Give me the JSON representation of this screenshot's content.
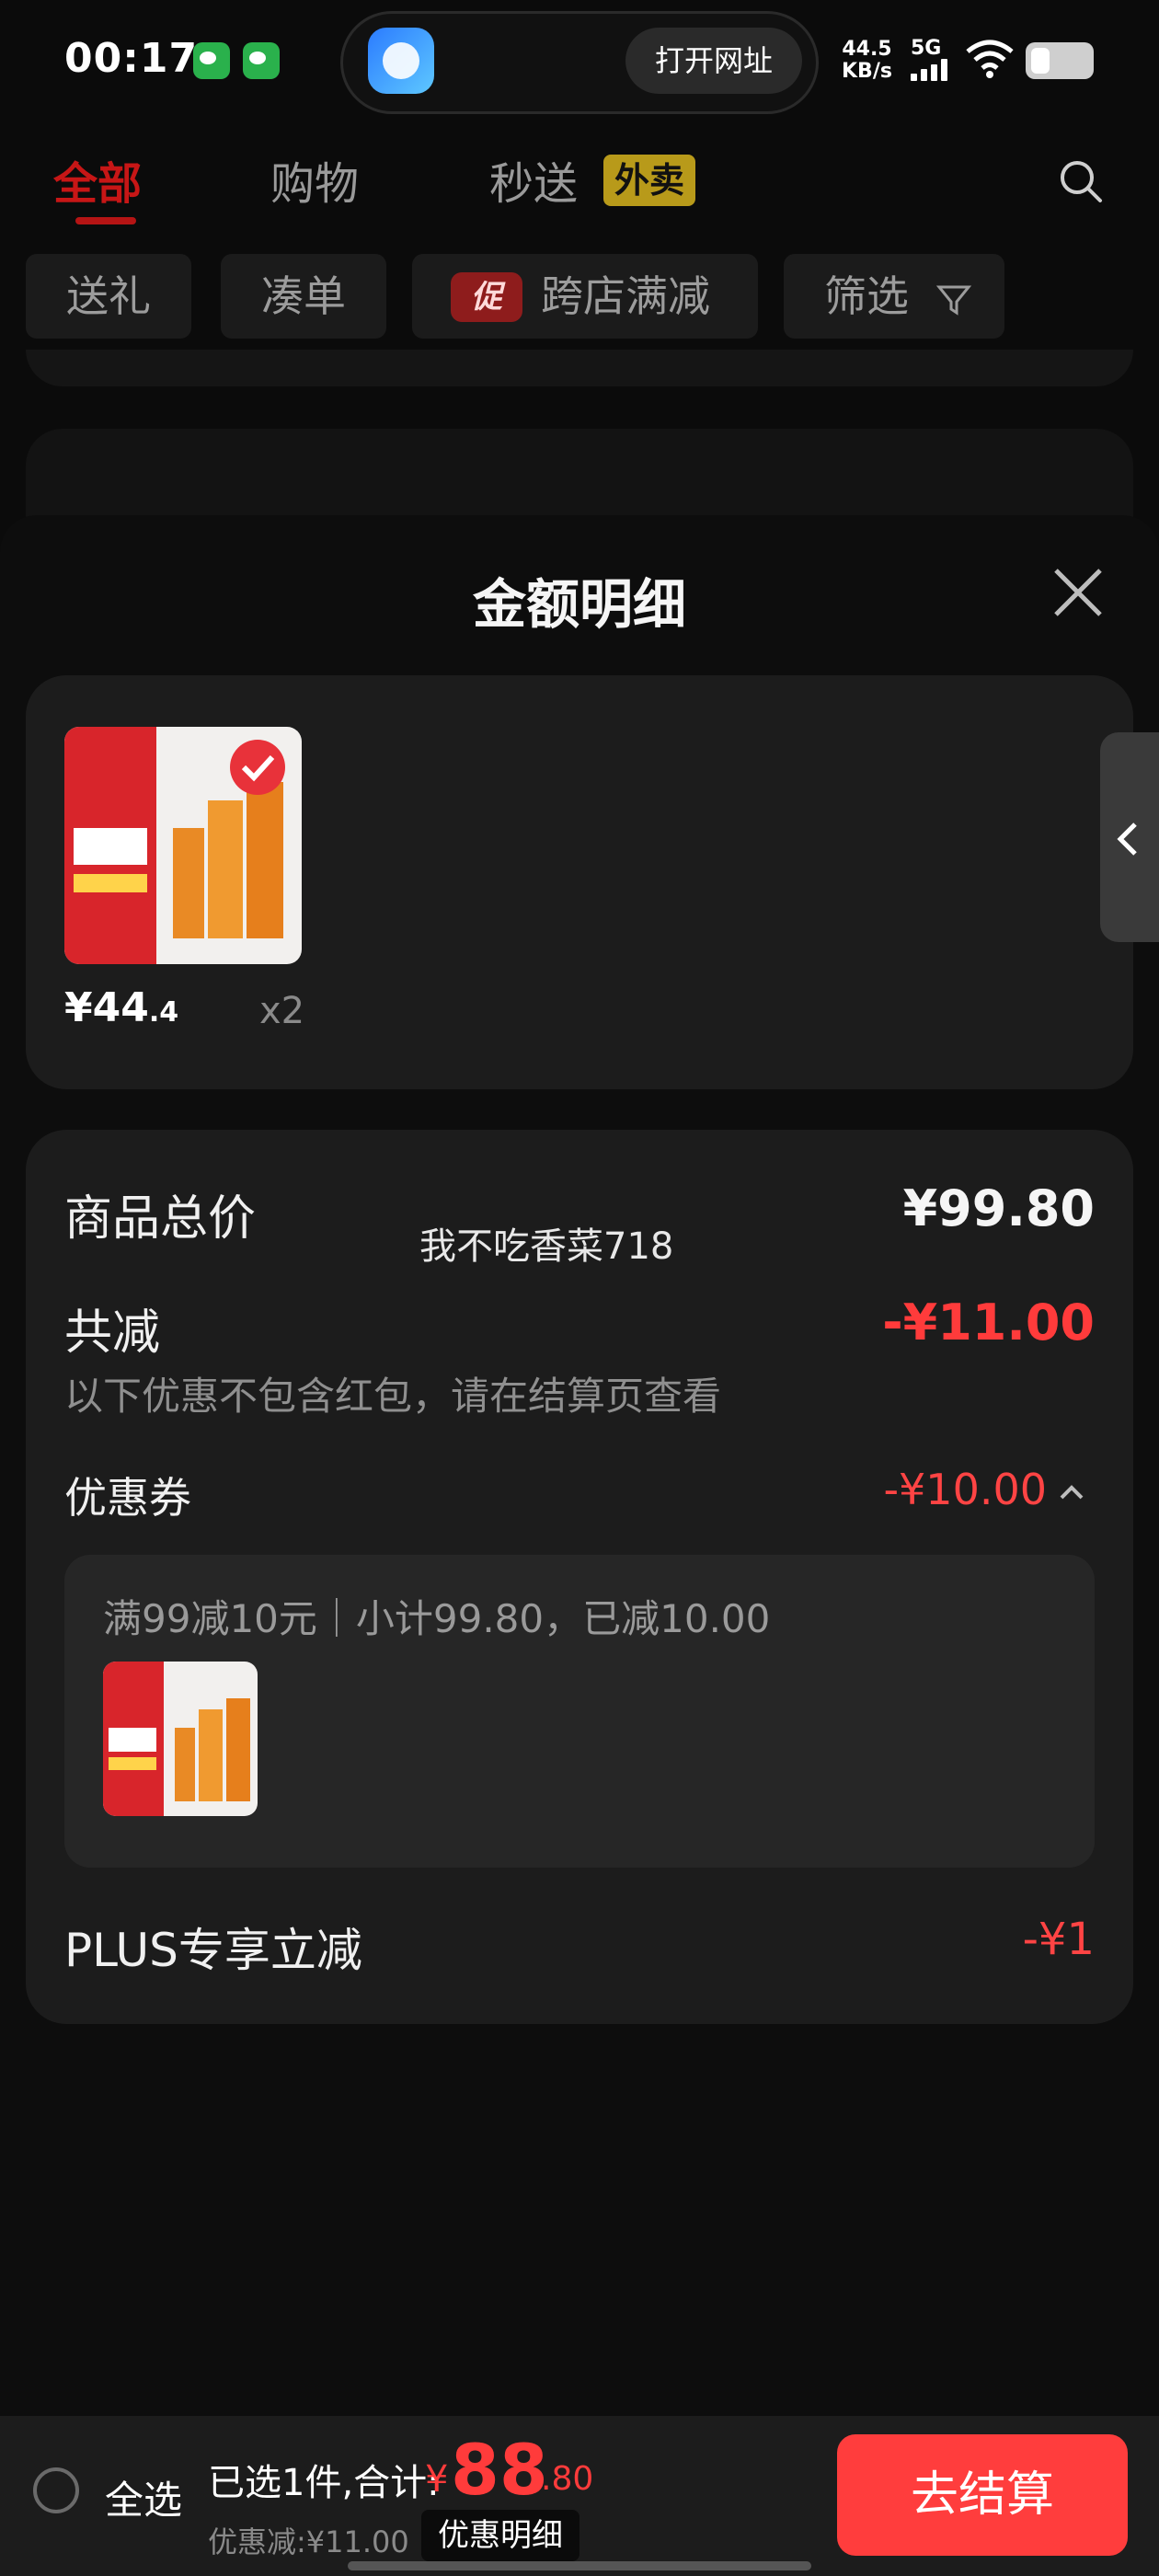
{
  "status_bar": {
    "time": "00:17",
    "open_url_label": "打开网址",
    "net_speed": "44.5",
    "net_unit": "KB/s",
    "signal_label": "5G"
  },
  "tabs": {
    "all": "全部",
    "shopping": "购物",
    "seconds": "秒送",
    "takeout_badge": "外卖"
  },
  "filters": {
    "gift": "送礼",
    "combine": "凑单",
    "promo_badge": "促",
    "cross_store": "跨店满减",
    "filter": "筛选"
  },
  "sheet": {
    "title": "金额明细",
    "product": {
      "price_int": "¥44",
      "price_dec": ".4",
      "quantity": "x2"
    },
    "total_label": "商品总价",
    "total_value": "¥99.80",
    "watermark": "我不吃香菜718",
    "reduce_label": "共减",
    "reduce_value": "-¥11.00",
    "reduce_note": "以下优惠不包含红包，请在结算页查看",
    "coupon_label": "优惠券",
    "coupon_value": "-¥10.00",
    "coupon_desc": "满99减10元｜小计99.80，已减10.00",
    "plus_label": "PLUS专享立减",
    "plus_value": "-¥1"
  },
  "bottom": {
    "select_all": "全选",
    "selected_text": "已选1件,合计:",
    "sum_currency": "¥",
    "sum_int": "88",
    "sum_dec": ".80",
    "discount_text": "优惠减:¥11.00",
    "detail_chip": "优惠明细",
    "checkout": "去结算"
  },
  "colors": {
    "accent_red": "#ff3b3b",
    "tab_active": "#c71616",
    "takeout_badge": "#b89a1a"
  },
  "icons": [
    "wechat-icon",
    "browser-icon",
    "wifi-icon",
    "battery-icon",
    "search-icon",
    "filter-icon",
    "close-icon",
    "chevron-left-icon",
    "chevron-up-icon",
    "check-icon"
  ]
}
